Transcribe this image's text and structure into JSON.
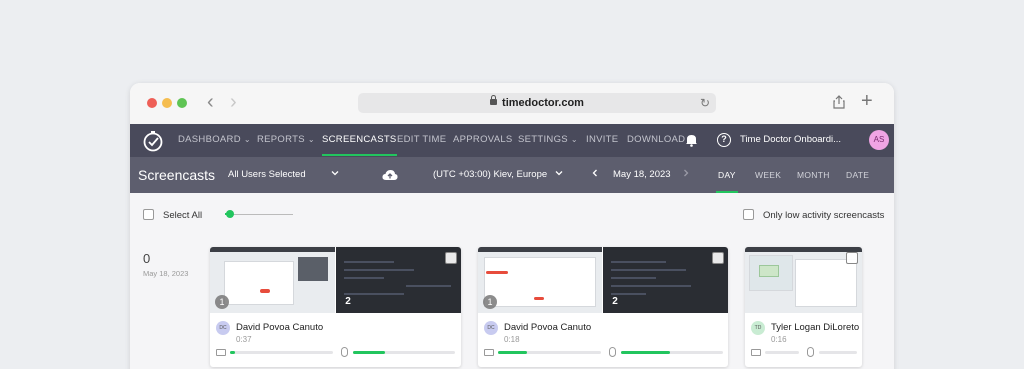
{
  "browser": {
    "url": "timedoctor.com"
  },
  "topnav": {
    "items": [
      {
        "label": "DASHBOARD",
        "has_caret": true
      },
      {
        "label": "REPORTS",
        "has_caret": true
      },
      {
        "label": "SCREENCASTS",
        "active": true
      },
      {
        "label": "EDIT TIME"
      },
      {
        "label": "APPROVALS"
      },
      {
        "label": "SETTINGS",
        "has_caret": true
      },
      {
        "label": "INVITE"
      },
      {
        "label": "DOWNLOAD"
      }
    ],
    "org_name": "Time Doctor Onboardi...",
    "avatar_initials": "AS",
    "help_glyph": "?"
  },
  "subnav": {
    "title": "Screencasts",
    "users_filter": "All Users Selected",
    "timezone": "(UTC +03:00) Kiev, Europe",
    "date": "May 18, 2023",
    "range_tabs": [
      {
        "label": "DAY",
        "active": true
      },
      {
        "label": "WEEK"
      },
      {
        "label": "MONTH"
      },
      {
        "label": "DATE RANGE"
      }
    ]
  },
  "controls": {
    "select_all": "Select All",
    "low_activity": "Only low activity screencasts",
    "zoom_level": 0.08
  },
  "hour_group": {
    "hour": "0",
    "date": "May 18, 2023"
  },
  "cards": [
    {
      "user": "David Povoa Canuto",
      "initials": "DC",
      "duration": "0:37",
      "shot1": "1",
      "shot2": "2",
      "keyboard": 0.05,
      "mouse": 0.31
    },
    {
      "user": "David Povoa Canuto",
      "initials": "DC",
      "duration": "0:18",
      "shot1": "1",
      "shot2": "2",
      "keyboard": 0.28,
      "mouse": 0.48
    },
    {
      "user": "Tyler Logan DiLoreto",
      "initials": "TD",
      "duration": "0:16",
      "shot1": "",
      "shot2": "",
      "keyboard": 0.0,
      "mouse": 0.0
    }
  ],
  "colors": {
    "accent": "#22c55e",
    "topnav_bg": "#494a5b",
    "subnav_bg": "#5d5e6e"
  }
}
